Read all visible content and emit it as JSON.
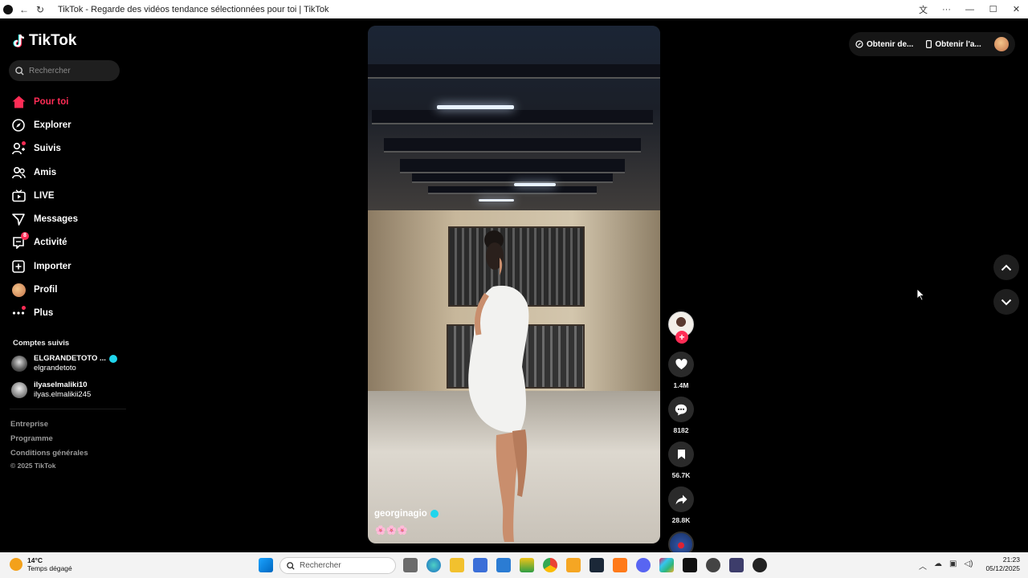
{
  "window": {
    "title": "TikTok - Regarde des vidéos tendance sélectionnées pour toi | TikTok"
  },
  "brand": {
    "name": "TikTok",
    "accent": "#fe2c55"
  },
  "search": {
    "placeholder": "Rechercher"
  },
  "nav": {
    "items": [
      {
        "label": "Pour toi",
        "icon": "home-icon",
        "active": true
      },
      {
        "label": "Explorer",
        "icon": "compass-icon"
      },
      {
        "label": "Suivis",
        "icon": "following-icon"
      },
      {
        "label": "Amis",
        "icon": "friends-icon"
      },
      {
        "label": "LIVE",
        "icon": "live-icon"
      },
      {
        "label": "Messages",
        "icon": "messages-icon"
      },
      {
        "label": "Activité",
        "icon": "activity-icon",
        "badge": "8"
      },
      {
        "label": "Importer",
        "icon": "upload-icon"
      },
      {
        "label": "Profil",
        "icon": "profile-avatar"
      },
      {
        "label": "Plus",
        "icon": "more-icon"
      }
    ]
  },
  "followed": {
    "title": "Comptes suivis",
    "accounts": [
      {
        "display": "ELGRANDETOTO ...",
        "handle": "elgrandetoto",
        "verified": true
      },
      {
        "display": "ilyaselmaliki10",
        "handle": "ilyas.elmalikii245",
        "verified": false
      }
    ]
  },
  "footer": {
    "links": [
      "Entreprise",
      "Programme",
      "Conditions générales"
    ],
    "copyright": "© 2025 TikTok"
  },
  "video": {
    "author": "georginagio",
    "verified": true,
    "description": "🌸🌸🌸"
  },
  "actions": {
    "likes": "1.4M",
    "comments": "8182",
    "saves": "56.7K",
    "shares": "28.8K"
  },
  "topright": {
    "coins_label": "Obtenir de...",
    "app_label": "Obtenir l'a..."
  },
  "taskbar": {
    "temp": "14°C",
    "weather": "Temps dégagé",
    "search_placeholder": "Rechercher",
    "time": "21:23",
    "date": "05/12/2025"
  }
}
